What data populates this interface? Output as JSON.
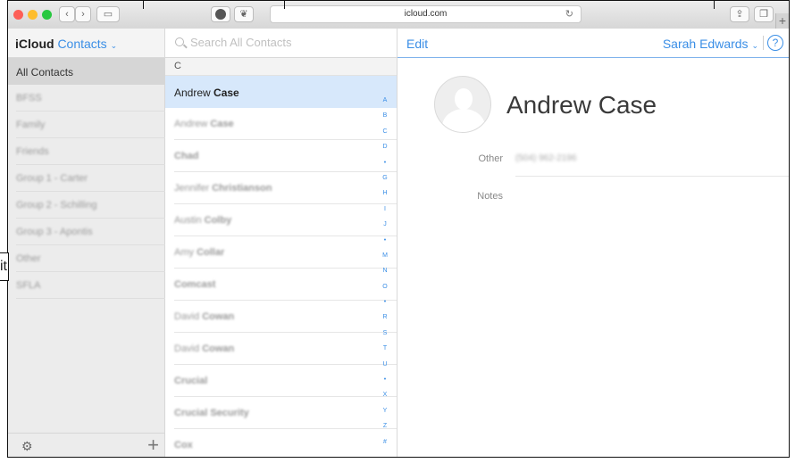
{
  "browser": {
    "url": "icloud.com"
  },
  "app": {
    "brand": "iCloud",
    "section": "Contacts",
    "edit": "Edit",
    "user": "Sarah Edwards",
    "help": "?"
  },
  "search": {
    "placeholder": "Search All Contacts"
  },
  "partial_label": "it",
  "groups": [
    {
      "label": "All Contacts",
      "selected": true
    },
    {
      "label": "BFSS"
    },
    {
      "label": "Family"
    },
    {
      "label": "Friends"
    },
    {
      "label": "Group 1 - Carter"
    },
    {
      "label": "Group 2 - Schilling"
    },
    {
      "label": "Group 3 - Apontis"
    },
    {
      "label": "Other"
    },
    {
      "label": "SFLA"
    }
  ],
  "section_letter": "C",
  "contacts": [
    {
      "first": "Andrew",
      "last": "Case",
      "selected": true
    },
    {
      "first": "Andrew",
      "last": "Case"
    },
    {
      "first": "",
      "last": "Chad"
    },
    {
      "first": "Jennifer",
      "last": "Christianson"
    },
    {
      "first": "Austin",
      "last": "Colby"
    },
    {
      "first": "Amy",
      "last": "Collar"
    },
    {
      "first": "",
      "last": "Comcast"
    },
    {
      "first": "David",
      "last": "Cowan"
    },
    {
      "first": "David",
      "last": "Cowan"
    },
    {
      "first": "",
      "last": "Crucial"
    },
    {
      "first": "",
      "last": "Crucial Security"
    },
    {
      "first": "",
      "last": "Cox"
    }
  ],
  "alpha_index": [
    "A",
    "B",
    "C",
    "D",
    "•",
    "G",
    "H",
    "I",
    "J",
    "•",
    "M",
    "N",
    "O",
    "•",
    "R",
    "S",
    "T",
    "U",
    "•",
    "X",
    "Y",
    "Z",
    "#"
  ],
  "detail": {
    "name": "Andrew Case",
    "other_label": "Other",
    "other_value": "(504) 962-2196",
    "notes_label": "Notes"
  }
}
